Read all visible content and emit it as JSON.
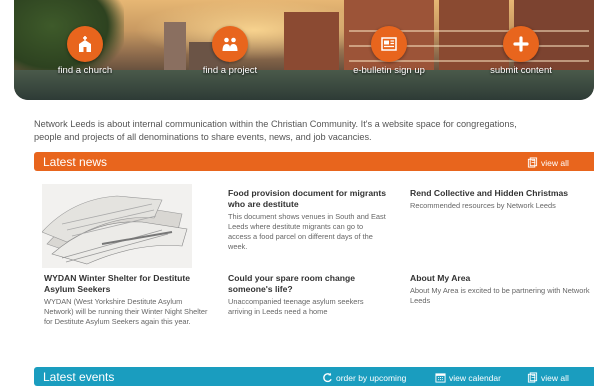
{
  "nav": {
    "church_label": "find a church",
    "project_label": "find a project",
    "ebulletin_label": "e-bulletin sign up",
    "submit_label": "submit content"
  },
  "intro": "Network Leeds is about internal communication within the Christian Community. It's a website space for congregations, people and projects of all denominations to share events, news, and job vacancies.",
  "latest_news": {
    "title": "Latest news",
    "view_all": "view all",
    "items": [
      {
        "title": "WYDAN Winter Shelter for Destitute Asylum Seekers",
        "body": "WYDAN (West Yorkshire Destitute Asylum Network) will be running their Winter Night Shelter for Destitute Asylum Seekers again this year."
      },
      {
        "title": "Food provision document for migrants who are destitute",
        "body": "This document shows venues in South and East Leeds where destitute migrants can go to access a food parcel on different days of the week."
      },
      {
        "title": "Rend Collective and Hidden Christmas",
        "body": "Recommended resources by Network Leeds"
      },
      {
        "title": "Could your spare room change someone's life?",
        "body": "Unaccompanied teenage asylum seekers arriving in Leeds need a home"
      },
      {
        "title": "About My Area",
        "body": "About My Area is excited to be partnering with Network Leeds"
      }
    ]
  },
  "latest_events": {
    "title": "Latest events",
    "order_label": "order by upcoming",
    "calendar_label": "view calendar",
    "view_all": "view all"
  },
  "colors": {
    "accent": "#e8651d",
    "events": "#1a9dbf"
  }
}
